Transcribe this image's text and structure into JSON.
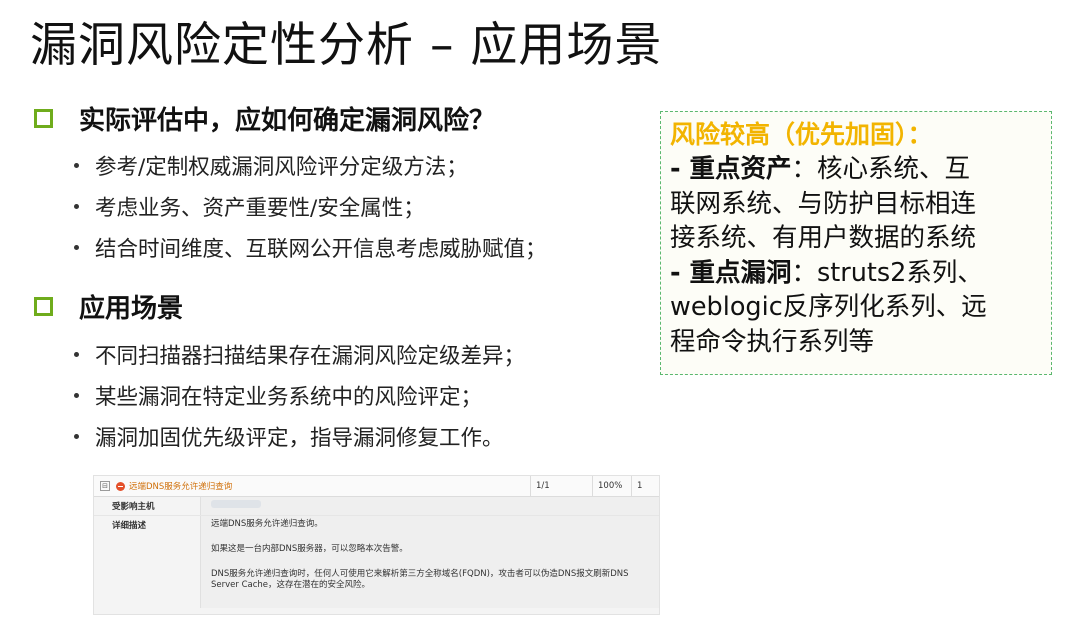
{
  "title": "漏洞风险定性分析 – 应用场景",
  "sections": [
    {
      "title": "实际评估中，应如何确定漏洞风险？",
      "bullets": [
        "参考/定制权威漏洞风险评分定级方法；",
        "考虑业务、资产重要性/安全属性；",
        "结合时间维度、互联网公开信息考虑威胁赋值；"
      ]
    },
    {
      "title": "应用场景",
      "bullets": [
        "不同扫描器扫描结果存在漏洞风险定级差异；",
        "某些漏洞在特定业务系统中的风险评定；",
        "漏洞加固优先级评定，指导漏洞修复工作。"
      ]
    }
  ],
  "callout": {
    "title": "风险较高（优先加固）：",
    "asset_label": " - 重点资产",
    "asset_text_1": "：核心系统、互",
    "asset_text_2": "联网系统、与防护目标相连",
    "asset_text_3": "接系统、有用户数据的系统",
    "vuln_label": " - 重点漏洞",
    "vuln_text_1": "：struts2系列、",
    "vuln_text_2": "weblogic反序列化系列、远",
    "vuln_text_3": "程命令执行系列等"
  },
  "screenshot": {
    "toggle_symbol": "⊟",
    "vuln_name": "远端DNS服务允许递归查询",
    "count": "1/1",
    "percent": "100%",
    "num": "1",
    "affected_host_label": "受影响主机",
    "detail_label": "详细描述",
    "detail_para_1": "远端DNS服务允许递归查询。",
    "detail_para_2": "如果这是一台内部DNS服务器，可以忽略本次告警。",
    "detail_para_3": "DNS服务允许递归查询时，任何人可使用它来解析第三方全称域名(FQDN)，攻击者可以伪造DNS报文刷新DNS Server Cache，这存在潜在的安全风险。"
  },
  "colors": {
    "accent_green": "#6fac1c",
    "callout_title": "#f2b400",
    "callout_border": "#5cb86f"
  }
}
